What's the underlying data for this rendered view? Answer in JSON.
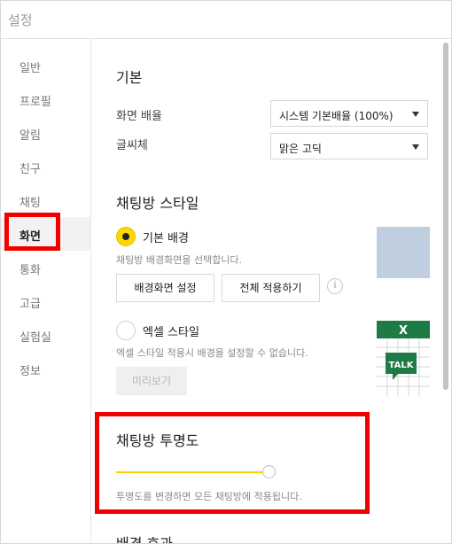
{
  "window": {
    "title": "설정"
  },
  "sidebar": {
    "items": [
      {
        "label": "일반"
      },
      {
        "label": "프로필"
      },
      {
        "label": "알림"
      },
      {
        "label": "친구"
      },
      {
        "label": "채팅"
      },
      {
        "label": "화면",
        "selected": true
      },
      {
        "label": "통화"
      },
      {
        "label": "고급"
      },
      {
        "label": "실험실"
      },
      {
        "label": "정보"
      }
    ]
  },
  "main": {
    "basic": {
      "title": "기본",
      "zoom_label": "화면 배율",
      "zoom_value": "시스템 기본배율 (100%)",
      "font_label": "글씨체",
      "font_value": "맑은 고딕"
    },
    "chatroom_style": {
      "title": "채팅방 스타일",
      "default_label": "기본 배경",
      "default_selected": true,
      "default_desc": "채팅방 배경화면을 선택합니다.",
      "set_bg_button": "배경화면 설정",
      "apply_all_button": "전체 적용하기",
      "info_icon": "i",
      "excel_label": "엑셀 스타일",
      "excel_selected": false,
      "excel_desc": "엑셀 스타일 적용시 배경을 설정할 수 없습니다.",
      "preview_button": "미리보기",
      "excel_preview_mark": "X",
      "excel_preview_talk": "TALK"
    },
    "transparency": {
      "title": "채팅방 투명도",
      "desc": "투명도를 변경하면 모든 채팅방에 적용됩니다.",
      "slider_value": 1.0
    },
    "next_section_title": "배경 효과"
  },
  "colors": {
    "accent": "#ffd800",
    "highlight": "#f20000",
    "excel_green": "#1e7b45",
    "preview_blue": "#bfcfe0"
  }
}
